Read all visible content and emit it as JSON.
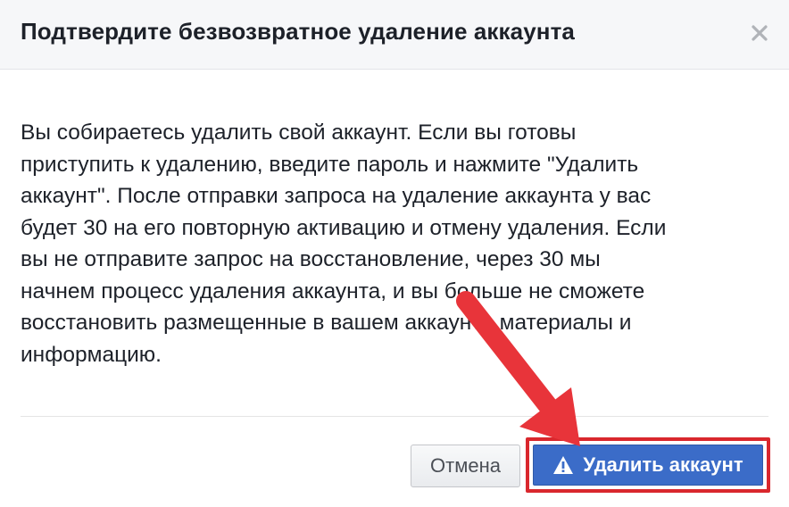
{
  "dialog": {
    "title": "Подтвердите безвозвратное удаление аккаунта",
    "close_icon": "close-icon",
    "body_lines": [
      "Вы собираетесь удалить свой аккаунт. Если вы готовы",
      "приступить к удалению, введите пароль и нажмите \"Удалить",
      "аккаунт\". После отправки запроса на удаление аккаунта у вас",
      "будет 30 на его повторную активацию и отмену удаления. Если",
      "вы не отправите запрос на восстановление, через 30 мы",
      "начнем процесс удаления аккаунта, и вы больше не сможете",
      "восстановить размещенные в вашем аккаунте материалы и",
      "информацию."
    ]
  },
  "buttons": {
    "cancel_label": "Отмена",
    "delete_label": "Удалить аккаунт",
    "delete_icon": "warning-icon"
  },
  "colors": {
    "primary_button": "#3b6cc8",
    "highlight": "#d9272d",
    "arrow": "#e8343a"
  }
}
